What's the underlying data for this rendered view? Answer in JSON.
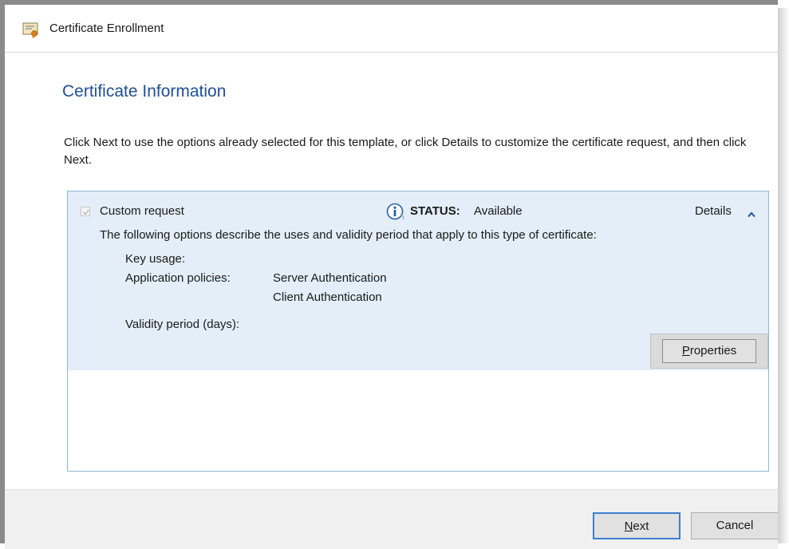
{
  "window": {
    "title": "Certificate Enrollment",
    "icon": "certificate-icon"
  },
  "page": {
    "heading": "Certificate Information",
    "intro": "Click Next to use the options already selected for this template, or click Details to customize the certificate request, and then click Next."
  },
  "template_item": {
    "name": "Custom request",
    "checked": true,
    "status_icon": "info-icon",
    "status_label": "STATUS:",
    "status_value": "Available",
    "details_label": "Details",
    "details_expanded": true,
    "description": "The following options describe the uses and validity period that apply to this type of certificate:",
    "key_usage_label": "Key usage:",
    "app_policies_label": "Application policies:",
    "app_policies": [
      "Server Authentication",
      "Client Authentication"
    ],
    "validity_label": "Validity period (days):",
    "properties_button": {
      "mnemonic": "P",
      "rest": "roperties"
    }
  },
  "footer": {
    "next_button": {
      "mnemonic": "N",
      "rest": "ext"
    },
    "cancel_button": "Cancel"
  },
  "colors": {
    "heading": "#1f4e9c",
    "item_background": "#e3eef9",
    "list_border": "#8fb4d6",
    "default_button_border": "#3c7fd1"
  }
}
